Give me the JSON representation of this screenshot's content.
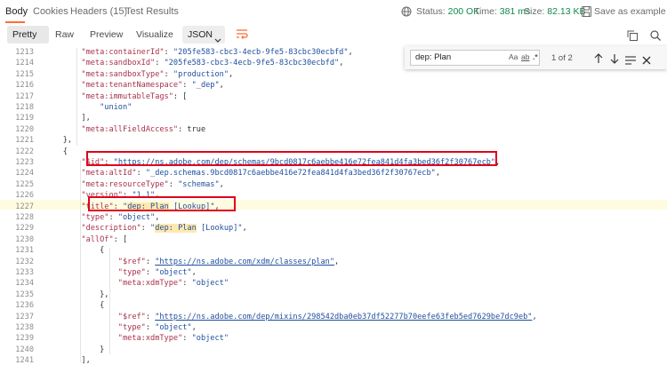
{
  "tabs": {
    "body": "Body",
    "cookies": "Cookies",
    "headers": "Headers (15)",
    "test_results": "Test Results"
  },
  "status": {
    "status_label": "Status:",
    "status_value": "200 OK",
    "time_label": "Time:",
    "time_value": "381 ms",
    "size_label": "Size:",
    "size_value": "82.13 KB",
    "save_label": "Save as example"
  },
  "toolbar": {
    "pretty": "Pretty",
    "raw": "Raw",
    "preview": "Preview",
    "visualize": "Visualize",
    "format_select": "JSON"
  },
  "find": {
    "query": "dep: Plan",
    "match_case": "Aa",
    "whole_word": "ab",
    "regex": ".*",
    "count": "1 of 2"
  },
  "code_lines": [
    {
      "n": "1213",
      "t": "        \"meta:containerId\": \"205fe583-cbc3-4ecb-9fe5-83cbc30ecbfd\","
    },
    {
      "n": "1214",
      "t": "        \"meta:sandboxId\": \"205fe583-cbc3-4ecb-9fe5-83cbc30ecbfd\","
    },
    {
      "n": "1215",
      "t": "        \"meta:sandboxType\": \"production\","
    },
    {
      "n": "1216",
      "t": "        \"meta:tenantNamespace\": \"_dep\","
    },
    {
      "n": "1217",
      "t": "        \"meta:immutableTags\": ["
    },
    {
      "n": "1218",
      "t": "            \"union\""
    },
    {
      "n": "1219",
      "t": "        ],"
    },
    {
      "n": "1220",
      "t": "        \"meta:allFieldAccess\": true"
    },
    {
      "n": "1221",
      "t": "    },"
    },
    {
      "n": "1222",
      "t": "    {"
    },
    {
      "n": "1223",
      "t": "        \"$id\": \"https://ns.adobe.com/dep/schemas/9bcd0817c6aebbe416e72fea841d4fa3bed36f2f30767ecb\","
    },
    {
      "n": "1224",
      "t": "        \"meta:altId\": \"_dep.schemas.9bcd0817c6aebbe416e72fea841d4fa3bed36f2f30767ecb\","
    },
    {
      "n": "1225",
      "t": "        \"meta:resourceType\": \"schemas\","
    },
    {
      "n": "1226",
      "t": "        \"version\": \"1.1\","
    },
    {
      "n": "1227",
      "t": "        \"title\": \"dep: Plan [Lookup]\","
    },
    {
      "n": "1228",
      "t": "        \"type\": \"object\","
    },
    {
      "n": "1229",
      "t": "        \"description\": \"dep: Plan [Lookup]\","
    },
    {
      "n": "1230",
      "t": "        \"allOf\": ["
    },
    {
      "n": "1231",
      "t": "            {"
    },
    {
      "n": "1232",
      "t": "                \"$ref\": \"https://ns.adobe.com/xdm/classes/plan\","
    },
    {
      "n": "1233",
      "t": "                \"type\": \"object\","
    },
    {
      "n": "1234",
      "t": "                \"meta:xdmType\": \"object\""
    },
    {
      "n": "1235",
      "t": "            },"
    },
    {
      "n": "1236",
      "t": "            {"
    },
    {
      "n": "1237",
      "t": "                \"$ref\": \"https://ns.adobe.com/dep/mixins/298542dba0eb37df52277b70eefe63feb5ed7629be7dc9eb\","
    },
    {
      "n": "1238",
      "t": "                \"type\": \"object\","
    },
    {
      "n": "1239",
      "t": "                \"meta:xdmType\": \"object\""
    },
    {
      "n": "1240",
      "t": "            }"
    },
    {
      "n": "1241",
      "t": "        ],"
    }
  ],
  "colors": {
    "accent": "#ff6c37",
    "status_ok": "#0f8a4b",
    "annotation_box": "#e0001a",
    "key": "#a8324a",
    "string": "#1e4e9c",
    "search_match": "#ffe8b0"
  }
}
